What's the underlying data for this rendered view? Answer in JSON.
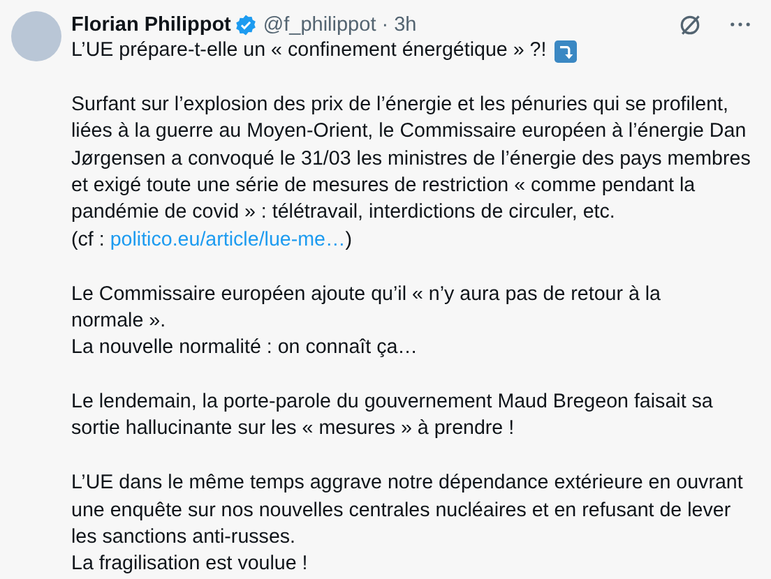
{
  "author": {
    "name": "Florian Philippot",
    "verified": true,
    "handle": "@f_philippot",
    "separator": "·",
    "time": "3h"
  },
  "paragraphs": [
    {
      "lines": [
        [
          {
            "kind": "text",
            "text": "L’UE prépare-t-elle un « confinement énergétique » ?!"
          },
          {
            "kind": "emoji"
          }
        ]
      ]
    },
    {
      "lines": [
        [
          {
            "kind": "text",
            "text": "Surfant sur l’explosion des prix de l’énergie et les pénuries qui se profilent,"
          }
        ],
        [
          {
            "kind": "text",
            "text": "liées à la guerre au Moyen-Orient, le Commissaire européen à l’énergie Dan"
          }
        ],
        [
          {
            "kind": "text",
            "text": "Jørgensen a convoqué le 31/03 les ministres de l’énergie des pays membres"
          }
        ],
        [
          {
            "kind": "text",
            "text": "et exigé toute une série de mesures de restriction « comme pendant la"
          }
        ],
        [
          {
            "kind": "text",
            "text": "pandémie de covid » : télétravail, interdictions de circuler, etc."
          }
        ],
        [
          {
            "kind": "text",
            "text": "(cf :"
          },
          {
            "kind": "link",
            "text": "politico.eu/article/lue-me…"
          },
          {
            "kind": "text",
            "text": ")"
          }
        ]
      ]
    },
    {
      "lines": [
        [
          {
            "kind": "text",
            "text": "Le Commissaire européen ajoute qu’il « n’y aura pas de retour à la"
          }
        ],
        [
          {
            "kind": "text",
            "text": "normale »."
          }
        ],
        [
          {
            "kind": "text",
            "text": "La nouvelle normalité : on connaît ça…"
          }
        ]
      ]
    },
    {
      "lines": [
        [
          {
            "kind": "text",
            "text": "Le lendemain, la porte-parole du gouvernement Maud Bregeon faisait sa"
          }
        ],
        [
          {
            "kind": "text",
            "text": "sortie hallucinante sur les « mesures » à prendre !"
          }
        ]
      ]
    },
    {
      "lines": [
        [
          {
            "kind": "text",
            "text": "L’UE dans le même temps aggrave notre dépendance extérieure en ouvrant"
          }
        ],
        [
          {
            "kind": "text",
            "text": "une enquête sur nos nouvelles centrales nucléaires et en refusant de lever"
          }
        ],
        [
          {
            "kind": "text",
            "text": "les sanctions anti-russes."
          }
        ],
        [
          {
            "kind": "text",
            "text": "La fragilisation est voulue !"
          }
        ]
      ]
    }
  ]
}
